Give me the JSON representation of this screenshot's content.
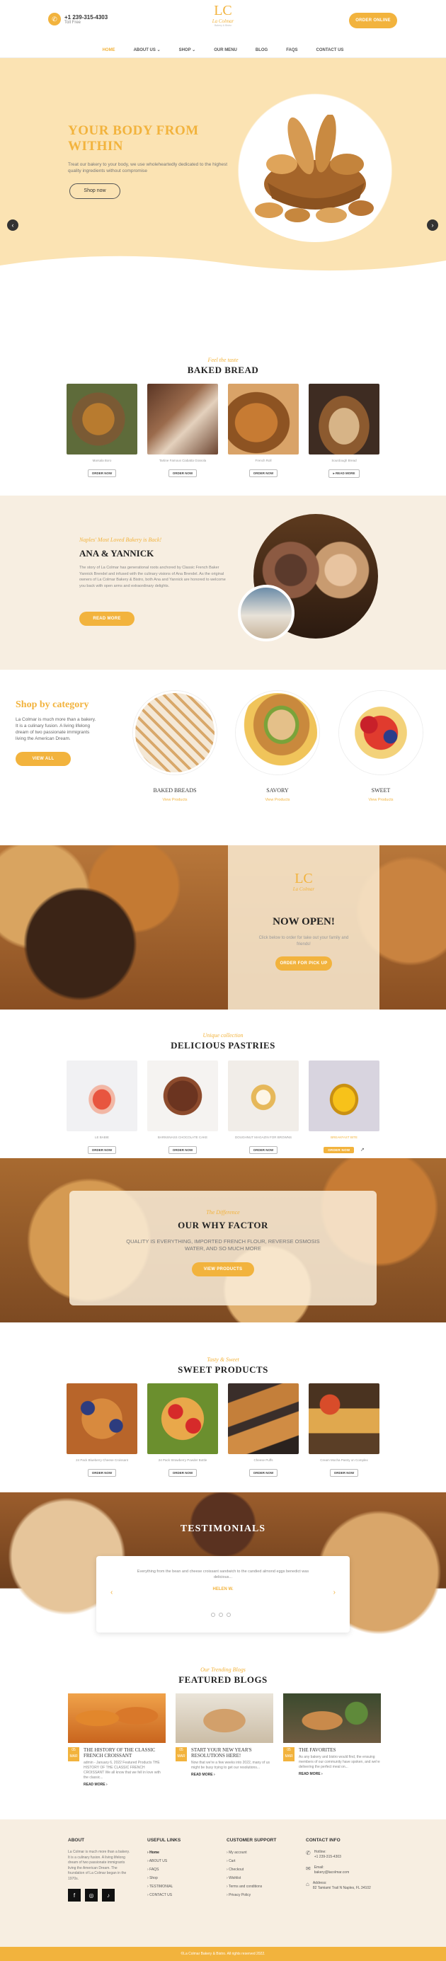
{
  "header": {
    "phone": "+1 239-315-4303",
    "phone_sub": "Toll Free",
    "logo_mark": "LC",
    "logo_name": "La Colmar",
    "logo_sub": "Bakery & Bistro",
    "order_label": "ORDER ONLINE",
    "nav": [
      "HOME",
      "ABOUT US ⌄",
      "SHOP ⌄",
      "OUR MENU",
      "BLOG",
      "FAQS",
      "CONTACT US"
    ]
  },
  "hero": {
    "title_line1": "YOUR BODY FROM",
    "title_line2": "WITHIN",
    "text": "Treat our bakery to your body, we use wholeheartedly dedicated to the highest quality ingredients without compromise",
    "cta": "Shop now"
  },
  "baked": {
    "eyebrow": "Feel the taste",
    "title": "BAKED BREAD",
    "items": [
      {
        "name": "Marsala Boro",
        "btn": "ORDER NOW"
      },
      {
        "name": "Tartine Famous Ciabatta Granola",
        "btn": "ORDER NOW"
      },
      {
        "name": "French Roll",
        "btn": "ORDER NOW"
      },
      {
        "name": "Sourdough Bread",
        "btn": "▸ READ MORE"
      }
    ]
  },
  "about": {
    "eyebrow": "Naples' Most Loved Bakery is Back!",
    "title": "ANA & YANNICK",
    "text": "The story of La Colmar has generational roots anchored by Classic French Baker Yannick Brendel and infused with the culinary visions of Ana Brendel. As the original owners of La Colmar Bakery & Bistro, both Ana and Yannick are honored to welcome you back with open arms and extraordinary delights.",
    "cta": "READ MORE"
  },
  "category": {
    "title": "Shop by category",
    "text": "La Colmar is much more than a bakery. It is a culinary fusion. A living lifelong dream of two passionate immigrants living the American Dream.",
    "cta": "VIEW ALL",
    "items": [
      {
        "name": "BAKED BREADS",
        "link": "View Products"
      },
      {
        "name": "SAVORY",
        "link": "View Products"
      },
      {
        "name": "SWEET",
        "link": "View Products"
      }
    ]
  },
  "open": {
    "logo_mark": "LC",
    "logo_name": "La Colmar",
    "title": "NOW OPEN!",
    "text": "Click below to order for take out your family and friends!",
    "cta": "ORDER FOR PICK UP"
  },
  "pastries": {
    "eyebrow": "Unique collection",
    "title": "DELICIOUS PASTRIES",
    "items": [
      {
        "name": "LE BABIE",
        "btn": "ORDER NOW"
      },
      {
        "name": "BARNSNASS CHOCOLATE CAKE",
        "btn": "ORDER NOW"
      },
      {
        "name": "DOUGHNUT MAGAZIN FOR BROWNS",
        "btn": "ORDER NOW"
      },
      {
        "name": "BREAKFAST BITE",
        "btn": "ORDER NOW"
      }
    ]
  },
  "why": {
    "eyebrow": "The Difference",
    "title": "OUR WHY FACTOR",
    "text": "QUALITY IS EVERYTHING, IMPORTED FRENCH FLOUR, REVERSE OSMOSIS WATER, AND SO MUCH MORE",
    "cta": "VIEW PRODUCTS"
  },
  "sweet": {
    "eyebrow": "Tasty & Sweet",
    "title": "SWEET PRODUCTS",
    "items": [
      {
        "name": "24 Pack Blueberry Cheese Croissant",
        "btn": "ORDER NOW"
      },
      {
        "name": "24 Pack Strawberry Powder Bottle",
        "btn": "ORDER NOW"
      },
      {
        "name": "Cheese Puffs",
        "btn": "ORDER NOW"
      },
      {
        "name": "Cream Mocha Pastry on Complex",
        "btn": "ORDER NOW"
      }
    ]
  },
  "testimonials": {
    "title": "TESTIMONIALS",
    "quote": "Everything from the bean and cheese croissant sandwich to the candied almond eggs benedict was delicious...",
    "author": "HELEN W.",
    "prev": "‹",
    "next": "›"
  },
  "blogs": {
    "eyebrow": "Our Trending Blogs",
    "title": "FEATURED BLOGS",
    "items": [
      {
        "day": "05",
        "mon": "MAR",
        "title": "THE HISTORY OF THE CLASSIC FRENCH CROISSANT",
        "text": "admin - January 6, 2022 Featured Products THE HISTORY OF THE CLASSIC FRENCH CROISSANT We all know that we fell in love with the classic...",
        "more": "READ MORE ›"
      },
      {
        "day": "05",
        "mon": "MAR",
        "title": "START YOUR NEW YEAR'S RESOLUTIONS HERE!",
        "text": "Now that we're a few weeks into 2022, many of us might be busy trying to get our resolutions...",
        "more": "READ MORE ›"
      },
      {
        "day": "05",
        "mon": "MAR",
        "title": "THE FAVORITES",
        "text": "As any bakery and bistro would find, the ensuing members of our community have spoken, and we're delivering the perfect meal on...",
        "more": "READ MORE ›"
      }
    ]
  },
  "footer": {
    "about_title": "ABOUT",
    "about_text": "La Colmar is much more than a bakery. It is a culinary fusion. A living lifelong dream of two passionate immigrants living the American Dream. The foundation of La Colmar began in the 1970s.",
    "links_title": "USEFUL LINKS",
    "links": [
      "Home",
      "ABOUT US",
      "FAQS",
      "Shop",
      "TESTIMONIAL",
      "CONTACT US"
    ],
    "support_title": "CUSTOMER SUPPORT",
    "support": [
      "My account",
      "Cart",
      "Checkout",
      "Wishlist",
      "Terms and conditions",
      "Privacy Policy"
    ],
    "contact_title": "CONTACT INFO",
    "contact": [
      {
        "label": "Hotline:",
        "value": "+1 239-315-4303"
      },
      {
        "label": "Email:",
        "value": "bakery@lacolmar.com"
      },
      {
        "label": "Address:",
        "value": "82 Tamiami Trail N Naples, FL 34102"
      }
    ],
    "social": [
      "f",
      "◎",
      "♪"
    ],
    "copyright": "©La Colmar Bakery & Bistro. All rights reserved 2022."
  },
  "colors": {
    "accent": "#f2b33d",
    "cream": "#fbe3b3",
    "beige": "#f7eee1"
  }
}
